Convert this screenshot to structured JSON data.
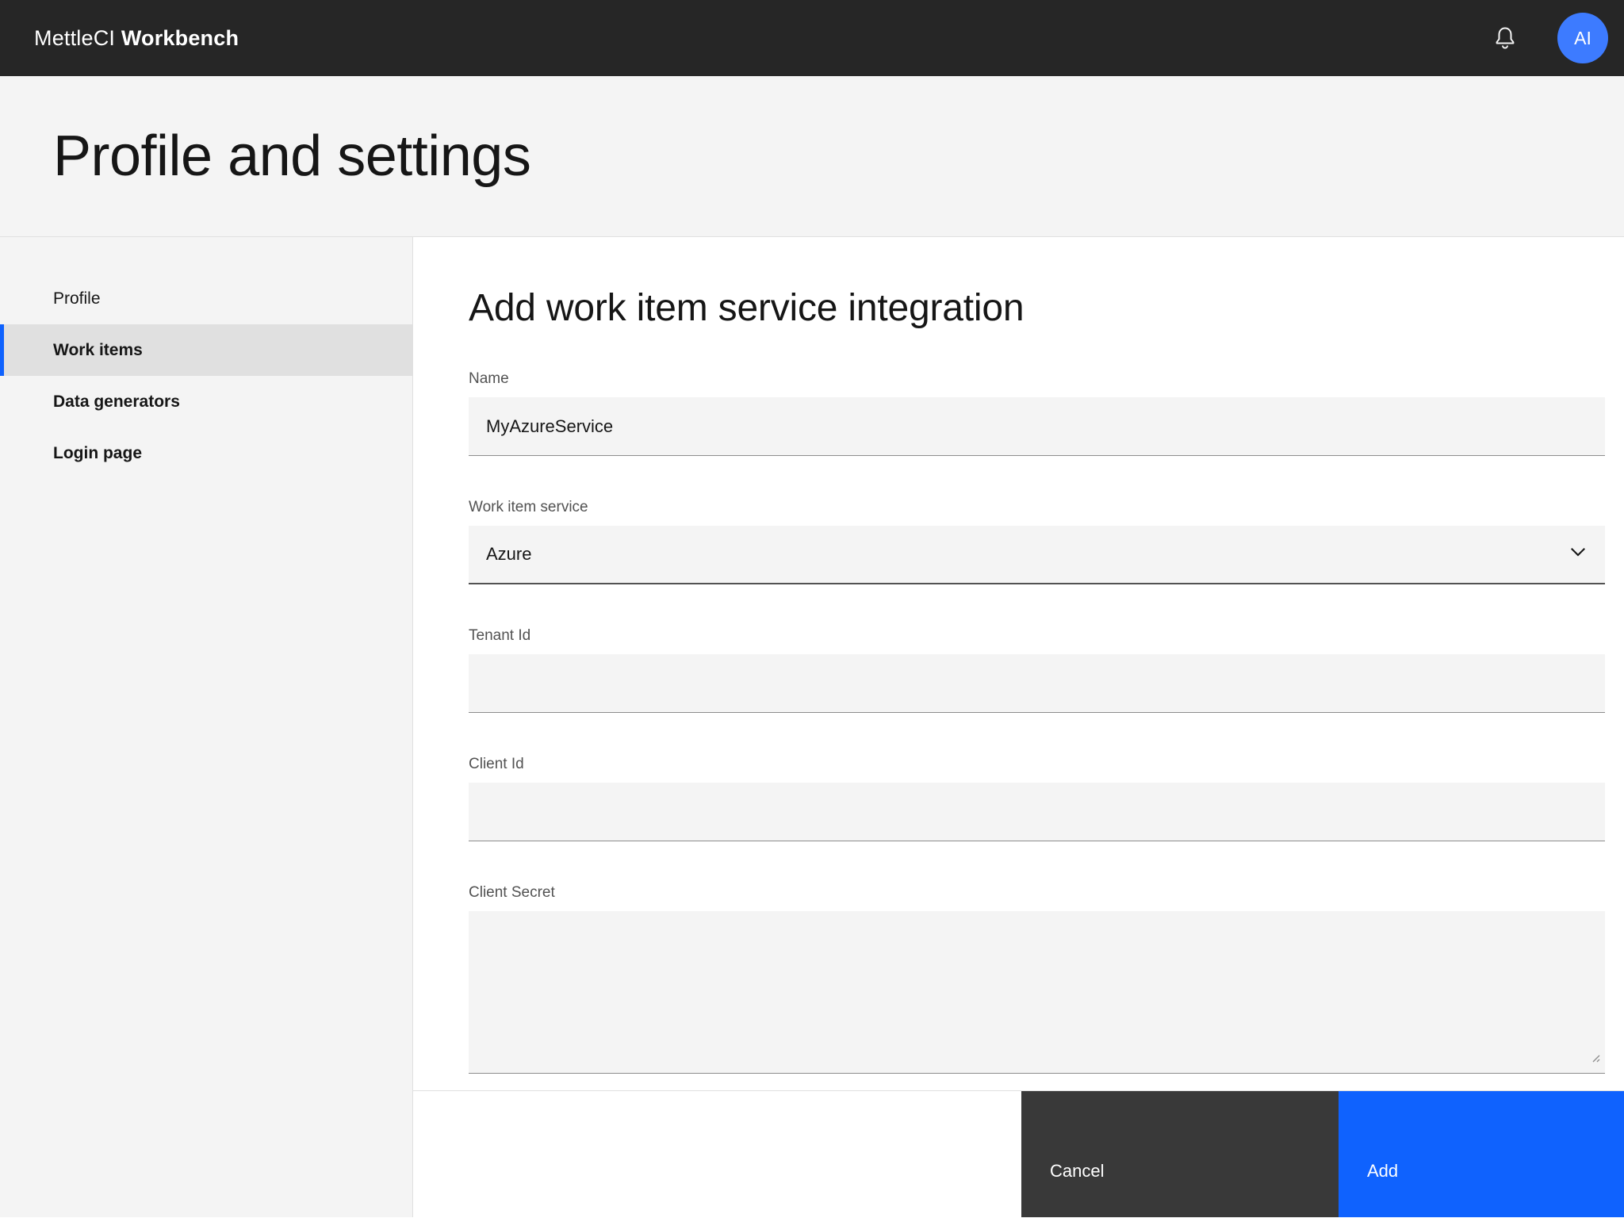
{
  "header": {
    "brand_prefix": "MettleCI ",
    "brand_bold": "Workbench",
    "avatar_initials": "AI",
    "icons": {
      "notifications": "bell-icon"
    }
  },
  "page": {
    "title": "Profile and settings"
  },
  "sidebar": {
    "items": [
      {
        "label": "Profile",
        "selected": false
      },
      {
        "label": "Work items",
        "selected": true
      },
      {
        "label": "Data generators",
        "selected": false
      },
      {
        "label": "Login page",
        "selected": false
      }
    ]
  },
  "main": {
    "heading": "Add work item service integration",
    "fields": {
      "name": {
        "label": "Name",
        "value": "MyAzureService"
      },
      "service": {
        "label": "Work item service",
        "value": "Azure",
        "icon": "chevron-down-icon"
      },
      "tenant_id": {
        "label": "Tenant Id",
        "value": ""
      },
      "client_id": {
        "label": "Client Id",
        "value": ""
      },
      "client_secret": {
        "label": "Client Secret",
        "value": ""
      }
    }
  },
  "footer": {
    "cancel_label": "Cancel",
    "add_label": "Add"
  },
  "colors": {
    "accent_blue": "#0f62fe",
    "header_bg": "#262626",
    "cancel_btn_bg": "#393939",
    "avatar_bg": "#3d7bff",
    "surface_gray": "#f4f4f4",
    "selected_nav_bg": "#e0e0e0",
    "field_border": "#8d8d8d"
  }
}
